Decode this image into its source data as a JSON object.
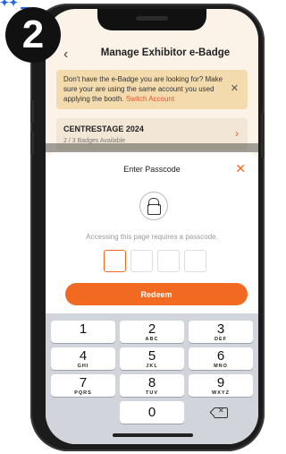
{
  "step": {
    "number": "2"
  },
  "header": {
    "back_icon": "chevron-left-icon",
    "title": "Manage Exhibitor e-Badge"
  },
  "notice": {
    "text": "Don't have the e-Badge you are looking for? Make sure your are using the same account you used applying the booth.",
    "link": "Switch Account",
    "close_icon": "close-icon"
  },
  "event": {
    "name": "CENTRESTAGE 2024",
    "subtitle": "2 / 3 Badges Available",
    "chevron_icon": "chevron-right-icon"
  },
  "passcode": {
    "title": "Enter Passcode",
    "close_icon": "close-icon",
    "lock_icon": "lock-icon",
    "message": "Accessing this page requires a passcode.",
    "boxes": [
      "",
      "",
      "",
      ""
    ],
    "redeem_label": "Redeem"
  },
  "keypad": {
    "keys": [
      {
        "n": "1",
        "l": ""
      },
      {
        "n": "2",
        "l": "ABC"
      },
      {
        "n": "3",
        "l": "DEF"
      },
      {
        "n": "4",
        "l": "GHI"
      },
      {
        "n": "5",
        "l": "JKL"
      },
      {
        "n": "6",
        "l": "MNO"
      },
      {
        "n": "7",
        "l": "PQRS"
      },
      {
        "n": "8",
        "l": "TUV"
      },
      {
        "n": "9",
        "l": "WXYZ"
      },
      {
        "n": "0",
        "l": ""
      }
    ],
    "delete_icon": "backspace-icon"
  },
  "colors": {
    "accent": "#f26a22",
    "notice_bg": "#f3dbae",
    "step_badge": "#111111"
  }
}
